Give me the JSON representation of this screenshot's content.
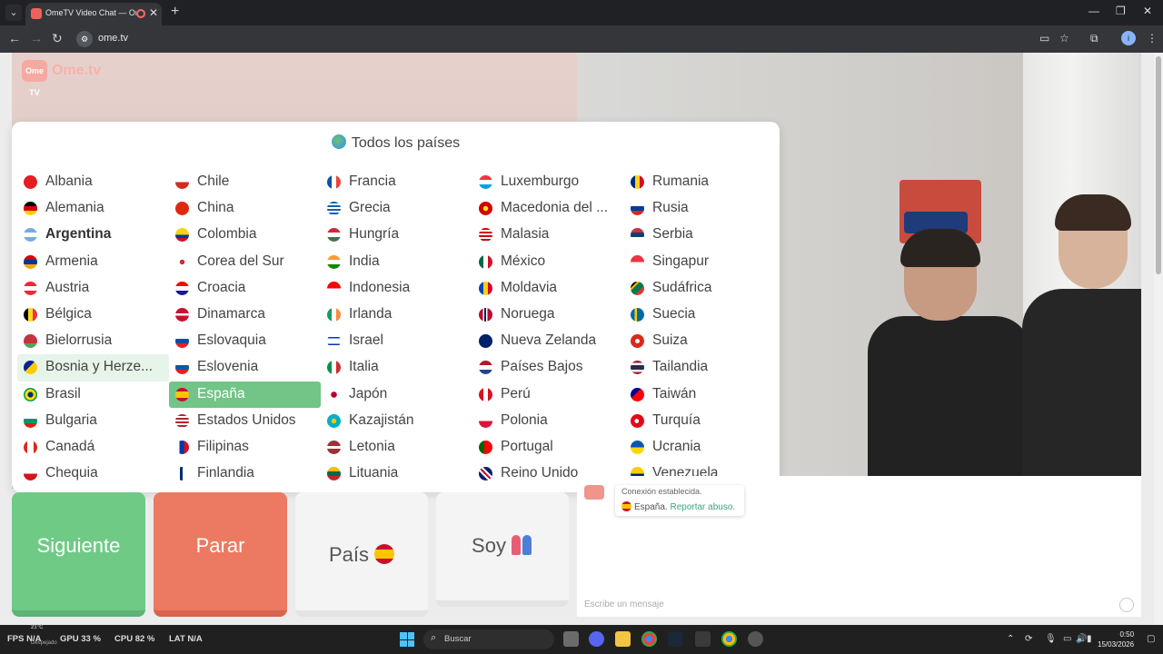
{
  "browser": {
    "tab_title": "OmeTV Video Chat — Ome",
    "url": "ome.tv",
    "site_icon": "site-info-icon"
  },
  "header": {
    "logo_badge": "Ome TV",
    "logo_text": "Ome.tv"
  },
  "country_panel": {
    "title": "Todos los países",
    "columns": [
      [
        "Albania",
        "Alemania",
        "Argentina",
        "Armenia",
        "Austria",
        "Bélgica",
        "Bielorrusia",
        "Bosnia y Herze...",
        "Brasil",
        "Bulgaria",
        "Canadá",
        "Chequia"
      ],
      [
        "Chile",
        "China",
        "Colombia",
        "Corea del Sur",
        "Croacia",
        "Dinamarca",
        "Eslovaquia",
        "Eslovenia",
        "España",
        "Estados Unidos",
        "Filipinas",
        "Finlandia"
      ],
      [
        "Francia",
        "Grecia",
        "Hungría",
        "India",
        "Indonesia",
        "Irlanda",
        "Israel",
        "Italia",
        "Japón",
        "Kazajistán",
        "Letonia",
        "Lituania"
      ],
      [
        "Luxemburgo",
        "Macedonia del ...",
        "Malasia",
        "México",
        "Moldavia",
        "Noruega",
        "Nueva Zelanda",
        "Países Bajos",
        "Perú",
        "Polonia",
        "Portugal",
        "Reino Unido"
      ],
      [
        "Rumania",
        "Rusia",
        "Serbia",
        "Singapur",
        "Sudáfrica",
        "Suecia",
        "Suiza",
        "Tailandia",
        "Taiwán",
        "Turquía",
        "Ucrania",
        "Venezuela"
      ]
    ],
    "selected": "España",
    "hovered": "Bosnia y Herze...",
    "highlighted": "Argentina"
  },
  "buttons": {
    "next": "Siguiente",
    "stop": "Parar",
    "country": "País",
    "me": "Soy"
  },
  "chat": {
    "status": "Conexión establecida.",
    "country": "España.",
    "report": "Reportar abuso.",
    "placeholder": "Escribe un mensaje"
  },
  "taskbar": {
    "fps_label": "FPS",
    "fps_value": "N/A",
    "gpu_label": "GPU",
    "gpu_value": "33 %",
    "cpu_label": "CPU",
    "cpu_value": "82 %",
    "lat_label": "LAT",
    "lat_value": "N/A",
    "weather": "21°C",
    "weather_sub": "Despejado",
    "search": "Buscar",
    "time": "0:50",
    "date": "15/03/2026"
  },
  "colors": {
    "next": "#6fca86",
    "stop": "#ec7a62",
    "selected": "#72c487",
    "hover": "#e7f4ea",
    "accent_link": "#3aa67a"
  }
}
